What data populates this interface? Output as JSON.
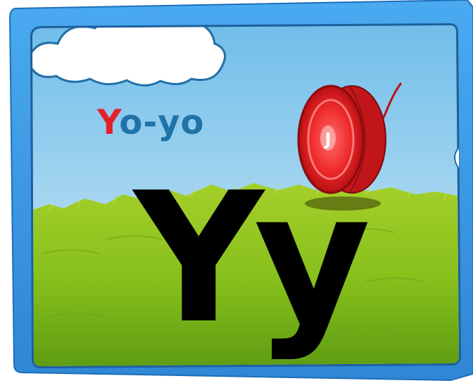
{
  "card": {
    "word_first_letter": "Y",
    "word_rest": "o-yo",
    "big_letters": "Yy",
    "icons": [
      "cloud-icon",
      "yoyo-icon"
    ]
  },
  "colors": {
    "frame_blue": "#3f9fe6",
    "sky_top": "#7fc6ee",
    "grass": "#8fc21e",
    "yoyo_red": "#e01d22",
    "word_red": "#e3202a",
    "word_blue": "#1f73a8"
  }
}
